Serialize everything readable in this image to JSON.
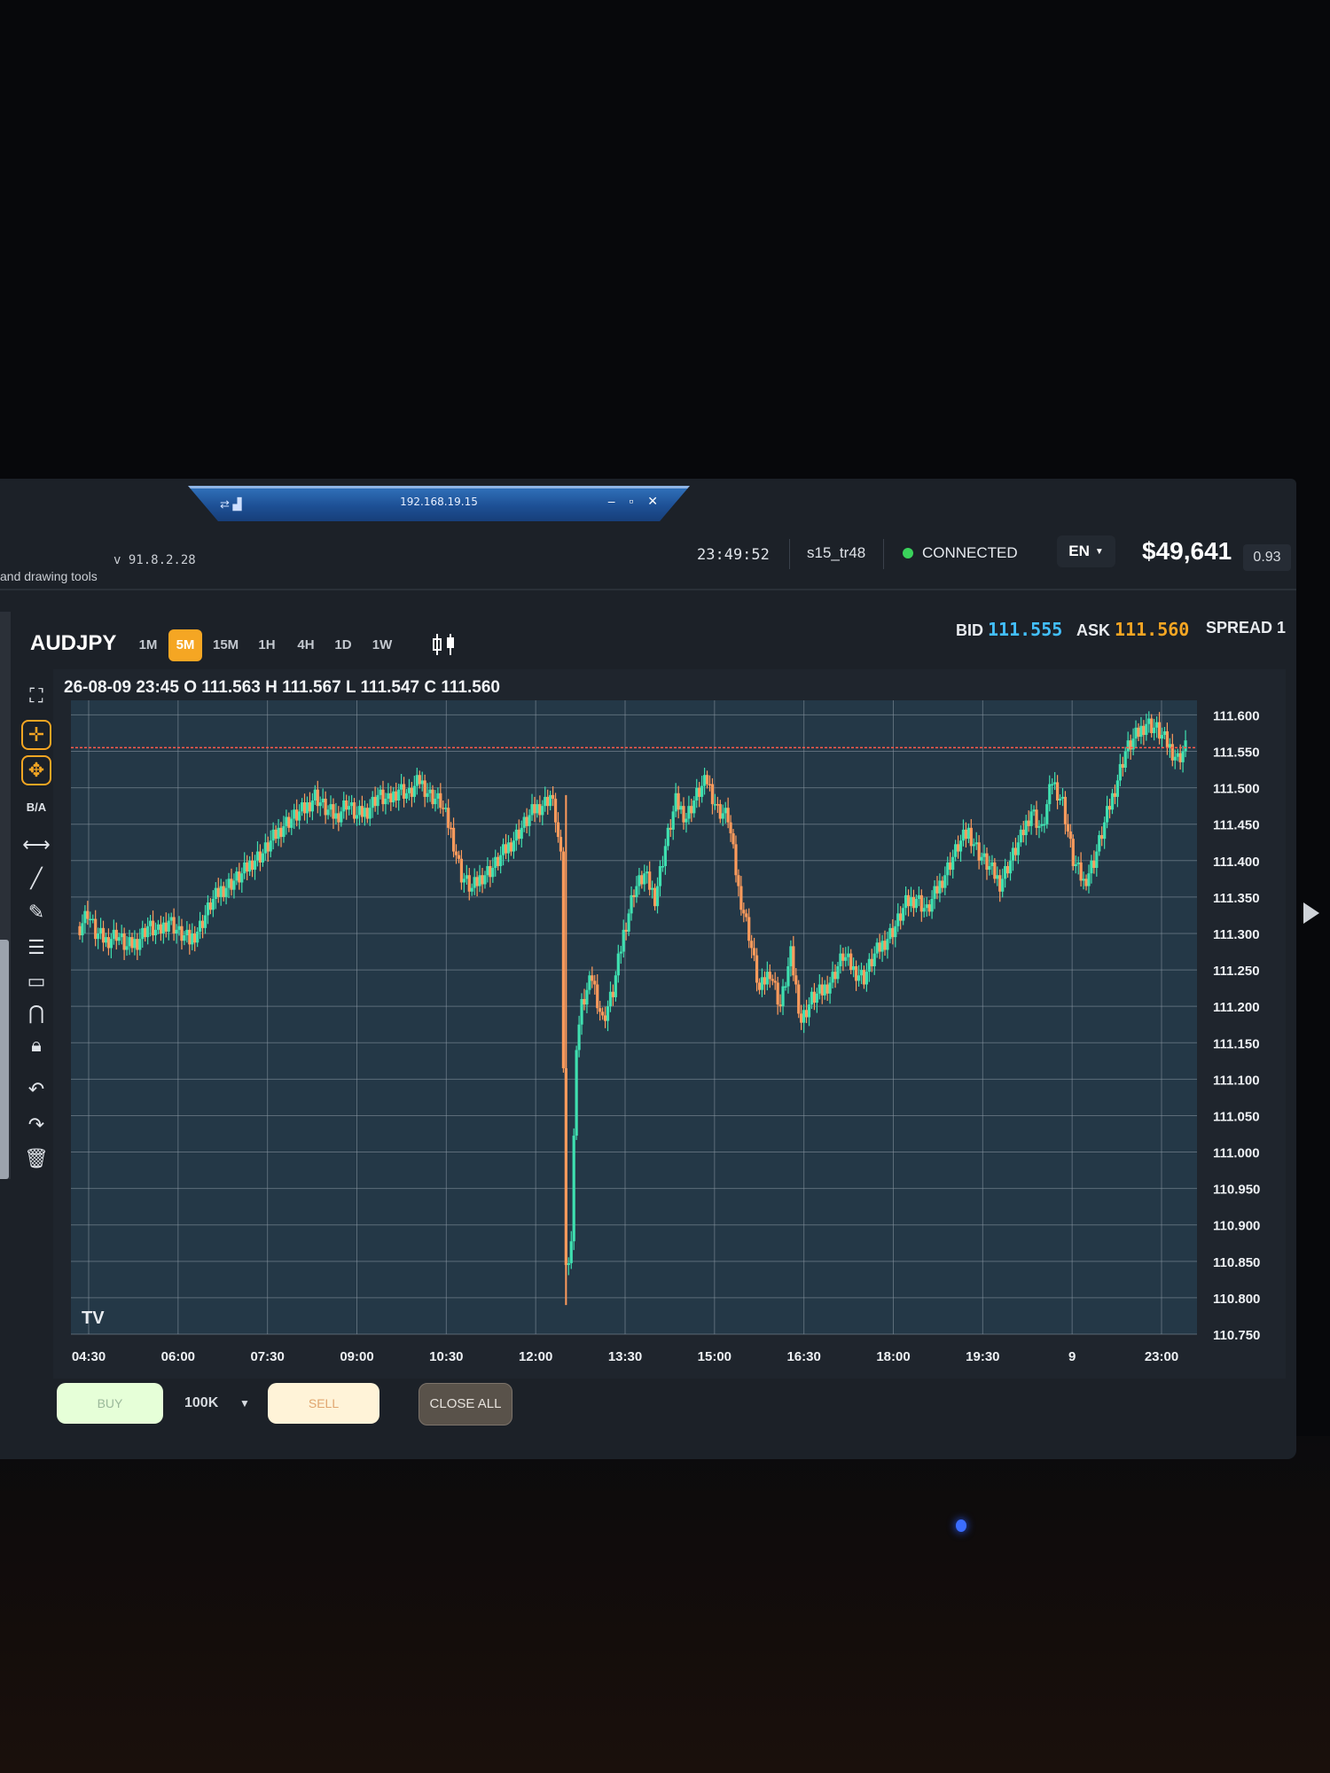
{
  "remote": {
    "ip": "192.168.19.15",
    "signal": "⇄ ▟",
    "controls": "– ▫ ✕"
  },
  "topbar": {
    "subtitle": "and drawing tools",
    "version": "v 91.8.2.28",
    "time": "23:49:52",
    "user": "s15_tr48",
    "status": "CONNECTED",
    "status_color": "#3ad25b",
    "language": "EN",
    "balance": "$49,641",
    "change": "0.93"
  },
  "symbol_bar": {
    "symbol": "AUDJPY",
    "timeframes": [
      "1M",
      "5M",
      "15M",
      "1H",
      "4H",
      "1D",
      "1W"
    ],
    "active_timeframe": "5M",
    "bid_label": "BID",
    "bid": "111.555",
    "ask_label": "ASK",
    "ask": "111.560",
    "spread_label": "SPREAD",
    "spread": "1",
    "accent": "#f5a623"
  },
  "tools": {
    "items": [
      "fullscreen-icon",
      "crosshair-icon",
      "move-icon",
      "B/A",
      "horizontal-ray-icon",
      "trendline-icon",
      "pencil-icon",
      "fib-lines-icon",
      "rectangle-icon",
      "magnet-icon",
      "lock-icon",
      "undo-icon",
      "redo-icon",
      "trash-icon"
    ],
    "ba_label": "B/A"
  },
  "ohlc": "26-08-09 23:45 O 111.563 H 111.567 L 111.547 C 111.560",
  "chart_data": {
    "type": "candlestick",
    "symbol": "AUDJPY",
    "interval": "5M",
    "watermark": "TV",
    "current_price_line": 111.555,
    "ylim": [
      110.75,
      111.62
    ],
    "y_ticks": [
      "111.600",
      "111.550",
      "111.500",
      "111.450",
      "111.400",
      "111.350",
      "111.300",
      "111.250",
      "111.200",
      "111.150",
      "111.100",
      "111.050",
      "111.000",
      "110.950",
      "110.900",
      "110.850",
      "110.800",
      "110.750"
    ],
    "x_ticks": [
      "04:30",
      "06:00",
      "07:30",
      "09:00",
      "10:30",
      "12:00",
      "13:30",
      "15:00",
      "16:30",
      "18:00",
      "19:30",
      "9",
      "23:00"
    ],
    "up_color": "#3fe0b0",
    "down_color": "#ff9b5c",
    "price_path": [
      [
        0,
        111.31
      ],
      [
        3,
        111.33
      ],
      [
        6,
        111.3
      ],
      [
        10,
        111.29
      ],
      [
        14,
        111.3
      ],
      [
        18,
        111.28
      ],
      [
        22,
        111.29
      ],
      [
        26,
        111.31
      ],
      [
        30,
        111.3
      ],
      [
        34,
        111.32
      ],
      [
        38,
        111.3
      ],
      [
        42,
        111.29
      ],
      [
        46,
        111.31
      ],
      [
        50,
        111.34
      ],
      [
        54,
        111.36
      ],
      [
        58,
        111.37
      ],
      [
        62,
        111.38
      ],
      [
        66,
        111.4
      ],
      [
        70,
        111.41
      ],
      [
        74,
        111.43
      ],
      [
        78,
        111.45
      ],
      [
        82,
        111.46
      ],
      [
        86,
        111.47
      ],
      [
        90,
        111.49
      ],
      [
        94,
        111.47
      ],
      [
        98,
        111.46
      ],
      [
        102,
        111.48
      ],
      [
        106,
        111.46
      ],
      [
        110,
        111.47
      ],
      [
        114,
        111.49
      ],
      [
        118,
        111.48
      ],
      [
        122,
        111.5
      ],
      [
        126,
        111.49
      ],
      [
        130,
        111.51
      ],
      [
        134,
        111.49
      ],
      [
        138,
        111.48
      ],
      [
        142,
        111.44
      ],
      [
        146,
        111.38
      ],
      [
        150,
        111.36
      ],
      [
        154,
        111.38
      ],
      [
        158,
        111.39
      ],
      [
        162,
        111.41
      ],
      [
        166,
        111.43
      ],
      [
        170,
        111.45
      ],
      [
        174,
        111.47
      ],
      [
        178,
        111.48
      ],
      [
        180,
        111.49
      ],
      [
        182,
        111.46
      ],
      [
        184,
        111.4
      ],
      [
        186,
        110.84
      ],
      [
        188,
        110.88
      ],
      [
        190,
        111.15
      ],
      [
        192,
        111.2
      ],
      [
        196,
        111.24
      ],
      [
        200,
        111.18
      ],
      [
        204,
        111.22
      ],
      [
        208,
        111.3
      ],
      [
        212,
        111.36
      ],
      [
        216,
        111.38
      ],
      [
        220,
        111.35
      ],
      [
        224,
        111.42
      ],
      [
        228,
        111.48
      ],
      [
        232,
        111.46
      ],
      [
        236,
        111.49
      ],
      [
        240,
        111.51
      ],
      [
        244,
        111.47
      ],
      [
        248,
        111.46
      ],
      [
        252,
        111.36
      ],
      [
        256,
        111.3
      ],
      [
        260,
        111.22
      ],
      [
        264,
        111.25
      ],
      [
        268,
        111.2
      ],
      [
        272,
        111.27
      ],
      [
        276,
        111.18
      ],
      [
        280,
        111.21
      ],
      [
        284,
        111.22
      ],
      [
        288,
        111.24
      ],
      [
        292,
        111.27
      ],
      [
        296,
        111.25
      ],
      [
        300,
        111.24
      ],
      [
        304,
        111.27
      ],
      [
        308,
        111.29
      ],
      [
        312,
        111.31
      ],
      [
        316,
        111.34
      ],
      [
        320,
        111.35
      ],
      [
        324,
        111.33
      ],
      [
        328,
        111.36
      ],
      [
        332,
        111.39
      ],
      [
        336,
        111.42
      ],
      [
        340,
        111.44
      ],
      [
        344,
        111.41
      ],
      [
        348,
        111.39
      ],
      [
        352,
        111.37
      ],
      [
        356,
        111.4
      ],
      [
        360,
        111.43
      ],
      [
        364,
        111.47
      ],
      [
        368,
        111.44
      ],
      [
        372,
        111.51
      ],
      [
        376,
        111.48
      ],
      [
        380,
        111.4
      ],
      [
        384,
        111.37
      ],
      [
        388,
        111.4
      ],
      [
        392,
        111.45
      ],
      [
        396,
        111.5
      ],
      [
        400,
        111.55
      ],
      [
        404,
        111.57
      ],
      [
        408,
        111.59
      ],
      [
        412,
        111.58
      ],
      [
        416,
        111.56
      ],
      [
        420,
        111.54
      ],
      [
        424,
        111.56
      ]
    ]
  },
  "footer": {
    "buy": "BUY",
    "quantity": "100K",
    "sell": "SELL",
    "close_all": "CLOSE ALL"
  }
}
